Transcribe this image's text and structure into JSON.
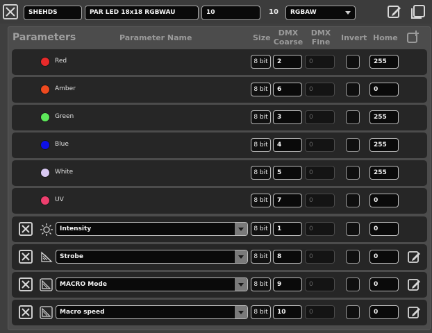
{
  "top": {
    "name": "SHEHDS",
    "model": "PAR LED 18x18 RGBWAU",
    "channels_input": "10",
    "channels_count": "10",
    "mode": "RGBAW"
  },
  "header": {
    "title": "Parameters",
    "col_name": "Parameter Name",
    "col_size": "Size",
    "col_coarse": "DMX\nCoarse",
    "col_fine": "DMX\nFine",
    "col_invert": "Invert",
    "col_home": "Home"
  },
  "color_rows": [
    {
      "label": "Red",
      "color": "#e82a2a",
      "size": "8 bit",
      "coarse": "2",
      "fine": "0",
      "home": "255"
    },
    {
      "label": "Amber",
      "color": "#ef4a1f",
      "size": "8 bit",
      "coarse": "6",
      "fine": "0",
      "home": "0"
    },
    {
      "label": "Green",
      "color": "#5de85a",
      "size": "8 bit",
      "coarse": "3",
      "fine": "0",
      "home": "255"
    },
    {
      "label": "Blue",
      "color": "#0d10e6",
      "size": "8 bit",
      "coarse": "4",
      "fine": "0",
      "home": "255"
    },
    {
      "label": "White",
      "color": "#d9c9f2",
      "size": "8 bit",
      "coarse": "5",
      "fine": "0",
      "home": "255"
    },
    {
      "label": "UV",
      "color": "#ee3f6e",
      "size": "8 bit",
      "coarse": "7",
      "fine": "0",
      "home": "0"
    }
  ],
  "param_rows": [
    {
      "label": "Intensity",
      "icon": "sun-icon",
      "size": "8 bit",
      "coarse": "1",
      "fine": "0",
      "home": "0",
      "editable": false
    },
    {
      "label": "Strobe",
      "icon": "strobe-icon",
      "size": "8 bit",
      "coarse": "8",
      "fine": "0",
      "home": "0",
      "editable": true
    },
    {
      "label": "MACRO Mode",
      "icon": "macro-icon",
      "size": "8 bit",
      "coarse": "9",
      "fine": "0",
      "home": "0",
      "editable": true
    },
    {
      "label": "Macro speed",
      "icon": "macro-icon",
      "size": "8 bit",
      "coarse": "10",
      "fine": "0",
      "home": "0",
      "editable": true
    }
  ]
}
